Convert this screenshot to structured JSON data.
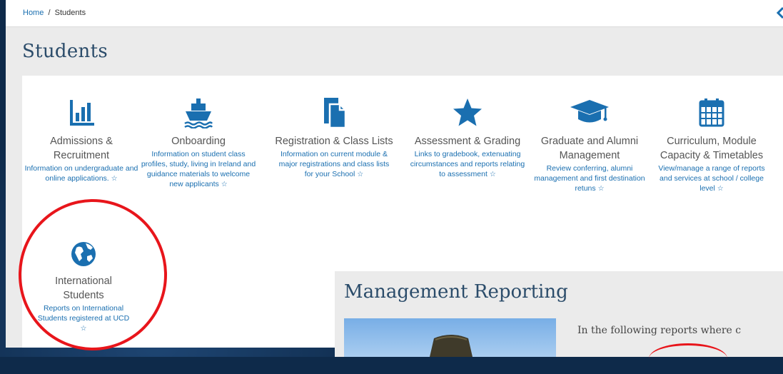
{
  "breadcrumb": {
    "home": "Home",
    "separator": "/",
    "current": "Students"
  },
  "page_title": "Students",
  "tiles": [
    {
      "icon": "bar-chart-icon",
      "title": "Admissions & Recruitment",
      "desc": "Information on undergraduate and online applications."
    },
    {
      "icon": "ship-icon",
      "title": "Onboarding",
      "desc": "Information on student class profiles, study, living in Ireland and guidance materials to welcome new applicants"
    },
    {
      "icon": "document-icon",
      "title": "Registration & Class Lists",
      "desc": "Information on current module & major registrations and class lists for your School"
    },
    {
      "icon": "star-icon",
      "title": "Assessment & Grading",
      "desc": "Links to gradebook, extenuating circumstances and reports relating to assessment"
    },
    {
      "icon": "graduation-cap-icon",
      "title": "Graduate and Alumni Management",
      "desc": "Review conferring, alumni management and first destination retuns"
    },
    {
      "icon": "calendar-icon",
      "title": "Curriculum, Module Capacity & Timetables",
      "desc": "View/manage a range of reports and services at school / college level"
    },
    {
      "icon": "globe-icon",
      "title": "International Students",
      "desc": "Reports on International Students registered at UCD"
    }
  ],
  "management": {
    "title": "Management Reporting",
    "text": "In the following reports where c"
  },
  "colors": {
    "accent": "#1a6fb0",
    "annotation": "#e8151b",
    "heading": "#2b4c6a"
  }
}
